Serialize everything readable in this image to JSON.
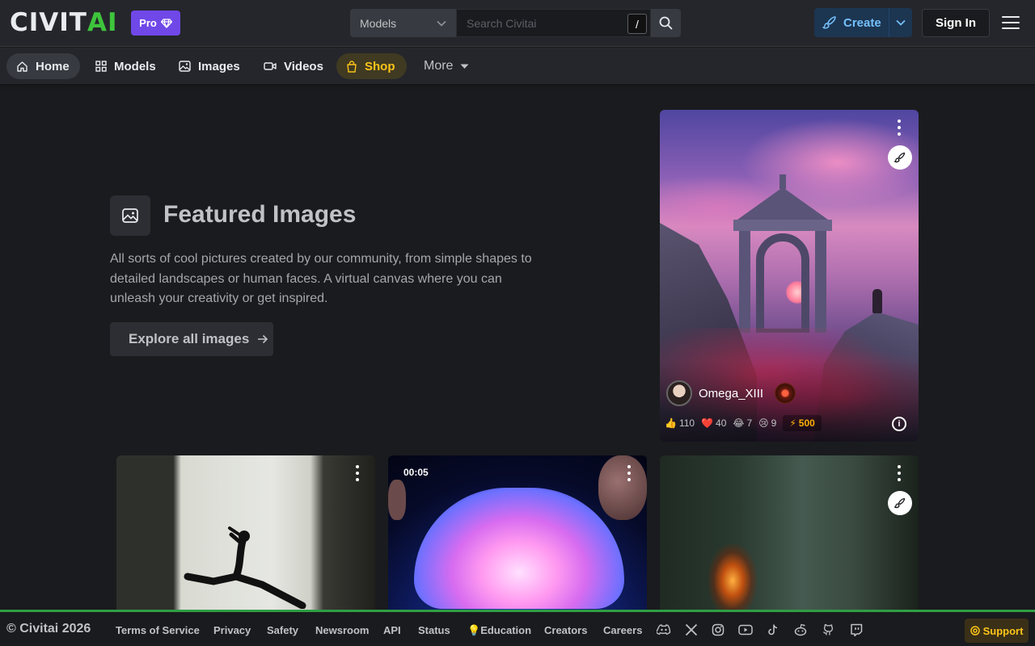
{
  "header": {
    "logo_left": "CIVIT",
    "logo_right": "AI",
    "pro_label": "Pro",
    "search_category": "Models",
    "search_placeholder": "Search Civitai",
    "search_shortcut": "/",
    "create_label": "Create",
    "signin_label": "Sign In"
  },
  "nav": {
    "items": [
      {
        "label": "Home",
        "icon": "home-icon"
      },
      {
        "label": "Models",
        "icon": "grid-icon"
      },
      {
        "label": "Images",
        "icon": "image-icon"
      },
      {
        "label": "Videos",
        "icon": "video-icon"
      },
      {
        "label": "Shop",
        "icon": "shopping-bag-icon"
      }
    ],
    "more_label": "More"
  },
  "featured": {
    "title": "Featured Images",
    "description": "All sorts of cool pictures created by our community, from simple shapes to detailed landscapes or human faces. A virtual canvas where you can unleash your creativity or get inspired.",
    "explore_label": "Explore all images"
  },
  "main_card": {
    "author": "Omega_XIII",
    "reactions": {
      "like": "110",
      "heart": "40",
      "laugh": "7",
      "cry": "9",
      "buzz": "500"
    }
  },
  "video_card": {
    "duration": "00:05"
  },
  "footer": {
    "copyright": "© Civitai 2026",
    "links": [
      "Terms of Service",
      "Privacy",
      "Safety",
      "Newsroom",
      "API",
      "Status",
      "Education",
      "Creators",
      "Careers"
    ],
    "support_label": "Support"
  },
  "colors": {
    "accent_green": "#2f9e44",
    "pro_purple": "#7048e8",
    "shop_yellow": "#fcc419",
    "create_blue": "#74c0fc"
  }
}
